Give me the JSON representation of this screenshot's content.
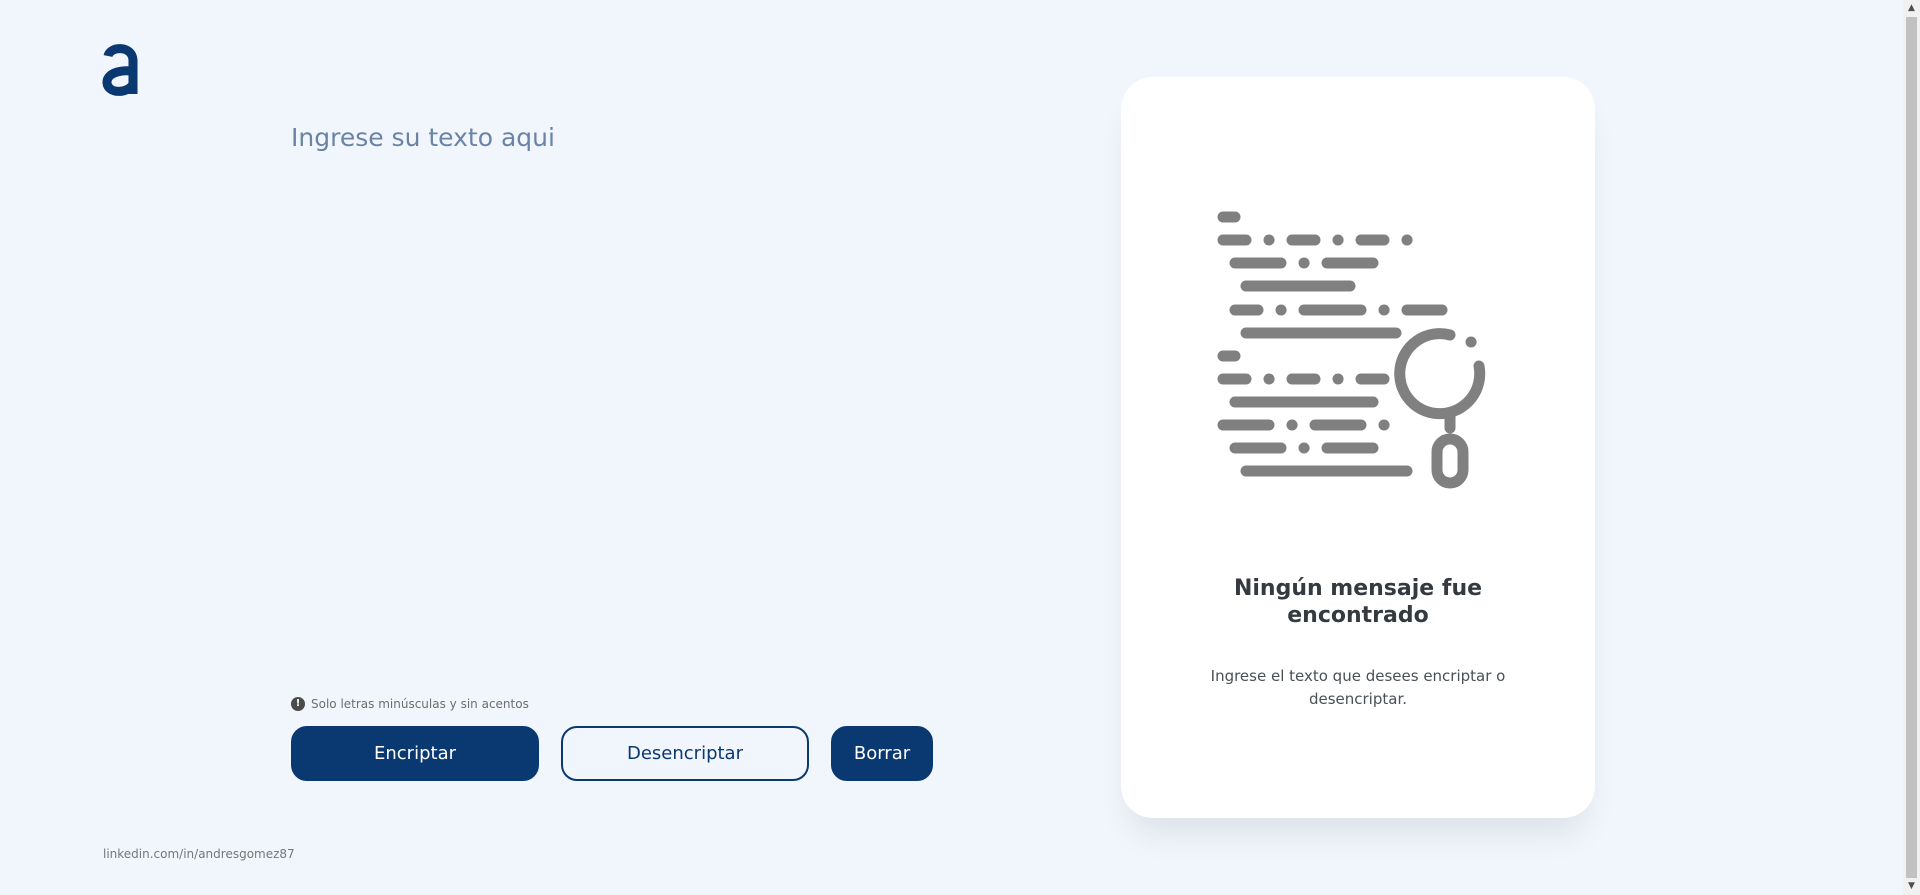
{
  "logo": {
    "icon": "alura-a-logo"
  },
  "input": {
    "placeholder": "Ingrese su texto aqui",
    "value": ""
  },
  "hint": {
    "icon": "exclamation-circle-icon",
    "text": "Solo letras minúsculas y sin acentos"
  },
  "buttons": {
    "encrypt_label": "Encriptar",
    "decrypt_label": "Desencriptar",
    "clear_label": "Borrar"
  },
  "footer": {
    "link_text": "linkedin.com/in/andresgomez87"
  },
  "result": {
    "illustration": "document-magnifier-icon",
    "title": "Ningún mensaje fue encontrado",
    "text": "Ingrese el texto que desees encriptar o desencriptar."
  },
  "scrollbar": {
    "up_icon": "▲",
    "down_icon": "▼"
  },
  "colors": {
    "background": "#f1f5fc",
    "primary": "#0a3871",
    "placeholder": "#6b84a6",
    "illustration": "#808080"
  }
}
